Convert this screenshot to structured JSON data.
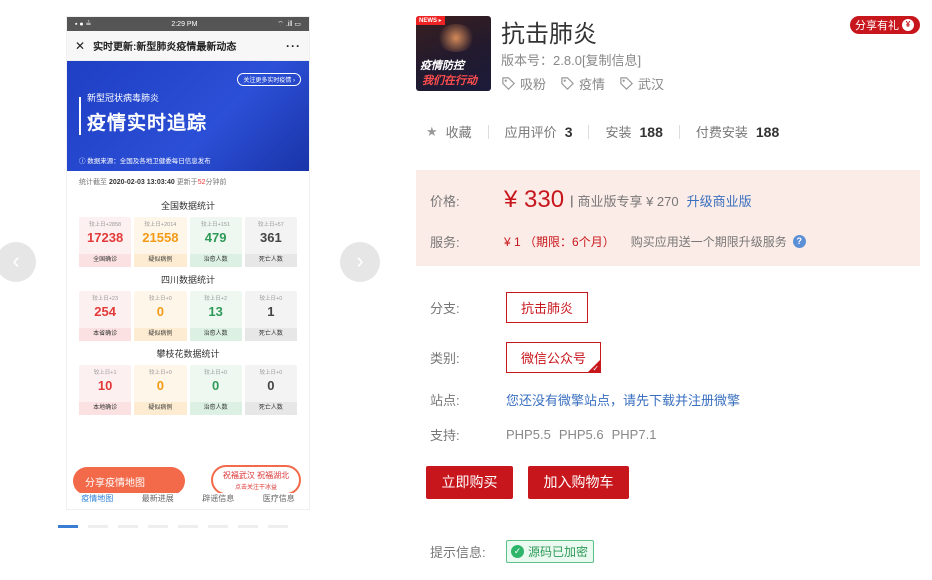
{
  "gallery": {
    "phone": {
      "status_time": "2:29 PM",
      "status_left": "▪ ● ≟",
      "status_right": "⌔ .ill ▭",
      "nav_close": "✕",
      "nav_title": "实时更新:新型肺炎疫情最新动态",
      "nav_more": "···",
      "hero_pill": "关注更多实时疫情 ›",
      "hero_sub": "新型冠状病毒肺炎",
      "hero_big": "疫情实时追踪",
      "hero_src": "ⓘ 数据来源：全国及各地卫健委每日信息发布",
      "stamp_prefix": "统计截至",
      "stamp_time": "2020-02-03 13:03:40",
      "stamp_mid": "更新于",
      "stamp_min": "52",
      "stamp_suffix": "分钟前",
      "sections": [
        {
          "title": "全国数据统计",
          "cells": [
            {
              "delta": "较上日+2858",
              "value": "17238",
              "label": "全国确诊"
            },
            {
              "delta": "较上日+2014",
              "value": "21558",
              "label": "疑似病例"
            },
            {
              "delta": "较上日+151",
              "value": "479",
              "label": "治愈人数"
            },
            {
              "delta": "较上日+57",
              "value": "361",
              "label": "死亡人数"
            }
          ]
        },
        {
          "title": "四川数据统计",
          "cells": [
            {
              "delta": "较上日+23",
              "value": "254",
              "label": "本省确诊"
            },
            {
              "delta": "较上日+0",
              "value": "0",
              "label": "疑似病例"
            },
            {
              "delta": "较上日+2",
              "value": "13",
              "label": "治愈人数"
            },
            {
              "delta": "较上日+0",
              "value": "1",
              "label": "死亡人数"
            }
          ]
        },
        {
          "title": "攀枝花数据统计",
          "cells": [
            {
              "delta": "较上日+1",
              "value": "10",
              "label": "本地确诊"
            },
            {
              "delta": "较上日+0",
              "value": "0",
              "label": "疑似病例"
            },
            {
              "delta": "较上日+0",
              "value": "0",
              "label": "治愈人数"
            },
            {
              "delta": "较上日+0",
              "value": "0",
              "label": "死亡人数"
            }
          ]
        }
      ],
      "fab_share": "分享疫情地图",
      "fab_bless_1": "祝福武汉 祝福湖北",
      "fab_bless_2": "点击关注干冰益",
      "tabs": [
        "疫情地图",
        "最新进展",
        "辟谣信息",
        "医疗信息"
      ]
    },
    "prev": "‹",
    "next": "›"
  },
  "app": {
    "icon_news": "NEWS ▸",
    "icon_line1": "疫情防控",
    "icon_line2": "我们在行动",
    "name": "抗击肺炎",
    "version_label": "版本号：",
    "version": "2.8.0",
    "copy_info": "[复制信息]",
    "tags": [
      "吸粉",
      "疫情",
      "武汉"
    ],
    "share": "分享有礼"
  },
  "stats": {
    "favorite": "收藏",
    "rating_label": "应用评价",
    "rating": "3",
    "install_label": "安装",
    "install": "188",
    "paid_label": "付费安装",
    "paid": "188"
  },
  "price": {
    "label": "价格:",
    "value": "¥ 330",
    "bar": "|",
    "biz": "商业版专享 ¥ 270",
    "upgrade": "升级商业版",
    "service_label": "服务:",
    "service_value": "¥ 1 （期限：6个月）",
    "service_desc": "购买应用送一个期限升级服务",
    "help": "?"
  },
  "fields": {
    "branch_label": "分支:",
    "branch": "抗击肺炎",
    "category_label": "类别:",
    "category": "微信公众号",
    "site_label": "站点:",
    "site_link": "您还没有微擎站点，请先下载并注册微擎",
    "support_label": "支持:",
    "php": [
      "PHP5.5",
      "PHP5.6",
      "PHP7.1"
    ]
  },
  "buttons": {
    "buy": "立即购买",
    "cart": "加入购物车"
  },
  "tip": {
    "label": "提示信息:",
    "badge": "源码已加密"
  },
  "colors": {
    "accent": "#c8161d",
    "link": "#3a6fbf",
    "price_bg": "#fcece7",
    "ok": "#2fb56a"
  }
}
